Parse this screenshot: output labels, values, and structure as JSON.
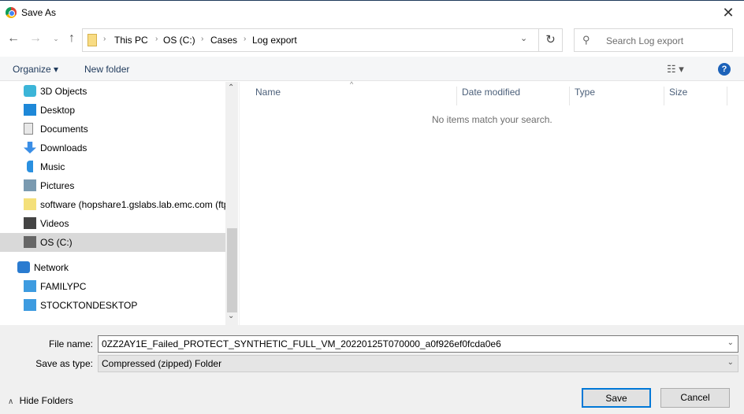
{
  "window": {
    "title": "Save As",
    "icon": "chrome-icon"
  },
  "address": {
    "crumbs": [
      "This PC",
      "OS (C:)",
      "Cases",
      "Log export"
    ],
    "search_placeholder": "Search Log export"
  },
  "toolbar": {
    "organize": "Organize ▾",
    "new_folder": "New folder",
    "help": "?"
  },
  "nav": {
    "items": [
      {
        "label": "3D Objects",
        "icon": "3d-objects-icon",
        "color": "#3cb5d8"
      },
      {
        "label": "Desktop",
        "icon": "desktop-icon",
        "color": "#1e88d8"
      },
      {
        "label": "Documents",
        "icon": "documents-icon",
        "color": "#e8e8e8"
      },
      {
        "label": "Downloads",
        "icon": "downloads-icon",
        "color": "#3a8ee6"
      },
      {
        "label": "Music",
        "icon": "music-icon",
        "color": "#2a90e0"
      },
      {
        "label": "Pictures",
        "icon": "pictures-icon",
        "color": "#7a9ab0"
      },
      {
        "label": "software (hopshare1.gslabs.lab.emc.com (ftp",
        "icon": "network-drive-icon",
        "color": "#f4e07a"
      },
      {
        "label": "Videos",
        "icon": "videos-icon",
        "color": "#444444"
      },
      {
        "label": "OS (C:)",
        "icon": "drive-icon",
        "color": "#666666",
        "selected": true
      },
      {
        "label": "Network",
        "icon": "network-icon",
        "color": "#2a7bd0"
      },
      {
        "label": "FAMILYPC",
        "icon": "computer-icon",
        "color": "#3d9be0"
      },
      {
        "label": "STOCKTONDESKTOP",
        "icon": "computer-icon",
        "color": "#3d9be0"
      }
    ]
  },
  "list": {
    "columns": [
      "Name",
      "Date modified",
      "Type",
      "Size"
    ],
    "empty_message": "No items match your search."
  },
  "form": {
    "file_name_label": "File name:",
    "file_name": "0ZZ2AY1E_Failed_PROTECT_SYNTHETIC_FULL_VM_20220125T070000_a0f926ef0fcda0e6",
    "type_label": "Save as type:",
    "type_value": "Compressed (zipped) Folder"
  },
  "buttons": {
    "save": "Save",
    "cancel": "Cancel",
    "hide_folders": "Hide Folders"
  }
}
